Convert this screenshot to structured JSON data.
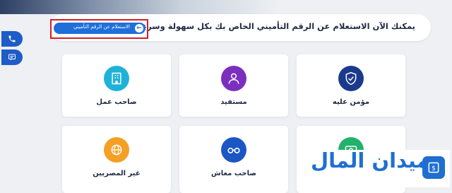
{
  "banner": {
    "text": "يمكنك الآن الاستعلام عن الرقم التأميني الخاص بك بكل سهولة وسرعة",
    "button_label": "الاستعلام عن الرقم التأميني",
    "button_icon": "arrow-left-icon"
  },
  "side": {
    "items": [
      {
        "icon": "phone-icon"
      },
      {
        "icon": "chat-icon"
      }
    ]
  },
  "cards": [
    {
      "label": "مؤمن عليه",
      "icon": "shield-check-icon",
      "color": "#1a3a8c"
    },
    {
      "label": "مستفيد",
      "icon": "user-icon",
      "color": "#7b2fbf"
    },
    {
      "label": "صاحب عمل",
      "icon": "building-icon",
      "color": "#1fb2d9"
    },
    {
      "label": "صاحب معاش",
      "icon": "glasses-icon",
      "color": "#1a57c4"
    },
    {
      "label": "غير المصريين",
      "icon": "globe-icon",
      "color": "#f4a024"
    },
    {
      "icon": "card-icon",
      "color": "#22b26b"
    }
  ],
  "logo": {
    "text": "ميدان المال",
    "icon": "money-icon",
    "color": "#1f6fd1"
  }
}
